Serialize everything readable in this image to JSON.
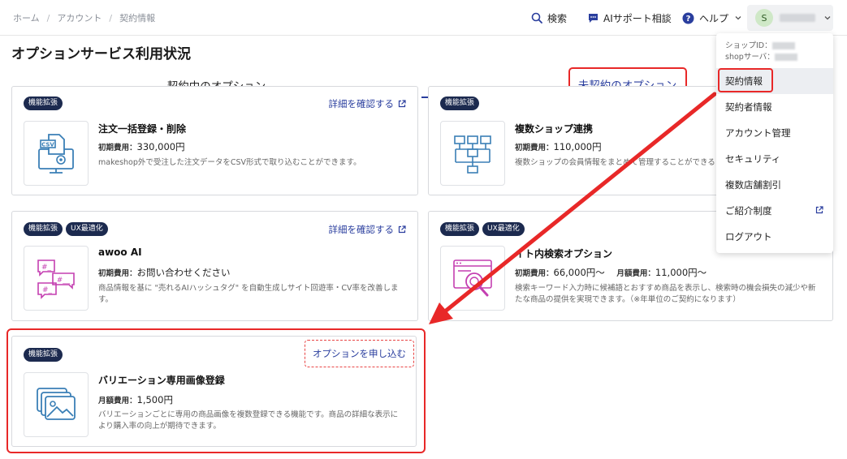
{
  "breadcrumb": [
    "ホーム",
    "アカウント",
    "契約情報"
  ],
  "header": {
    "search_label": "検索",
    "ai_support_label": "AIサポート相談",
    "help_label": "ヘルプ",
    "user_initial": "S"
  },
  "page_title": "オプションサービス利用状況",
  "tabs": [
    {
      "label": "契約中のオプション"
    },
    {
      "label": "未契約のオプション"
    }
  ],
  "cards": [
    {
      "badges": [
        "機能拡張"
      ],
      "link": "詳細を確認する",
      "title": "注文一括登録・削除",
      "price_label": "初期費用：",
      "price_value": "330,000円",
      "description": "makeshop外で受注した注文データをCSV形式で取り込むことができます。",
      "icon": "csv-monitor-icon"
    },
    {
      "badges": [
        "機能拡張"
      ],
      "link": "",
      "title": "複数ショップ連携",
      "price_label": "初期費用：",
      "price_value": "110,000円",
      "description": "複数ショップの会員情報をまとめて管理することができる",
      "icon": "network-icon"
    },
    {
      "badges": [
        "機能拡張",
        "UX最適化"
      ],
      "link": "詳細を確認する",
      "title": "awoo AI",
      "price_label": "初期費用：",
      "price_value": "お問い合わせください",
      "description": "商品情報を基に \"売れるAIハッシュタグ\" を自動生成しサイト回遊率・CV率を改善します。",
      "icon": "hashtag-chat-icon"
    },
    {
      "badges": [
        "機能拡張",
        "UX最適化"
      ],
      "link": "",
      "title": "イト内検索オプション",
      "price_label": "初期費用：",
      "price_value": "66,000円〜",
      "price2_label": "月額費用：",
      "price2_value": "11,000円〜",
      "description": "検索キーワード入力時に候補語とおすすめ商品を表示し、検索時の機会損失の減少や新たな商品の提供を実現できます。（※年単位のご契約になります）",
      "icon": "search-window-icon"
    },
    {
      "badges": [
        "機能拡張"
      ],
      "button": "オプションを申し込む",
      "title": "バリエーション専用画像登録",
      "price_label": "月額費用：",
      "price_value": "1,500円",
      "description": "バリエーションごとに専用の商品画像を複数登録できる機能です。商品の詳細な表示により購入率の向上が期待できます。",
      "icon": "images-stack-icon"
    }
  ],
  "dropdown": {
    "shop_id_label": "ショップID：",
    "shop_server_label": "shopサーバ：",
    "items": [
      "契約情報",
      "契約者情報",
      "アカウント管理",
      "セキュリティ",
      "複数店舗割引",
      "ご紹介制度",
      "ログアウト"
    ]
  },
  "colors": {
    "accent": "#2a3e9e",
    "badge_bg": "#1c2a4f",
    "highlight": "#e82828",
    "icon_blue": "#3a7fb6",
    "icon_pink": "#c43fb1"
  }
}
